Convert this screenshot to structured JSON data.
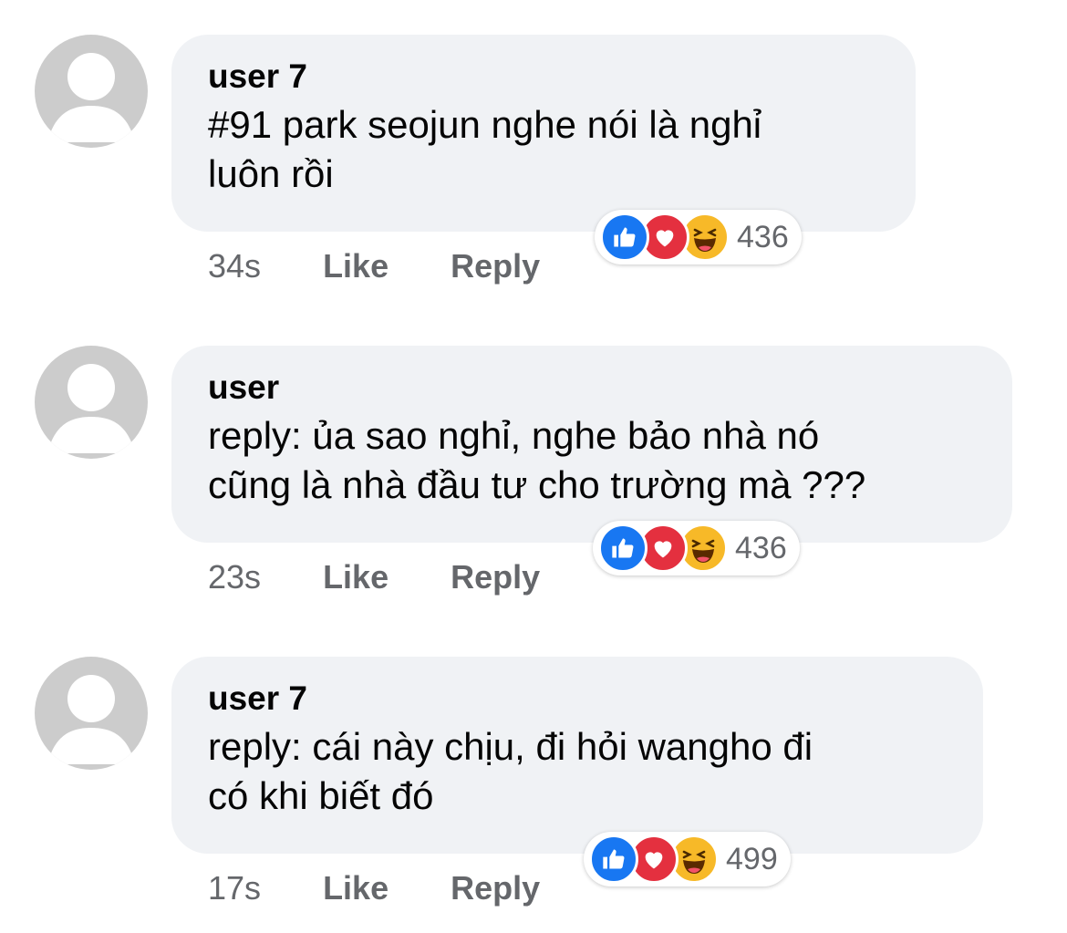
{
  "comments": [
    {
      "author": "user 7",
      "text": "#91 park seojun nghe nói là nghỉ\nluôn rồi",
      "time": "34s",
      "like_label": "Like",
      "reply_label": "Reply",
      "reaction_count": "436",
      "reactions": [
        "like-icon",
        "love-icon",
        "haha-icon"
      ]
    },
    {
      "author": "user",
      "text": "reply: ủa sao nghỉ, nghe bảo nhà nó\ncũng là nhà đầu tư cho trường mà ???",
      "time": "23s",
      "like_label": "Like",
      "reply_label": "Reply",
      "reaction_count": "436",
      "reactions": [
        "like-icon",
        "love-icon",
        "haha-icon"
      ]
    },
    {
      "author": "user 7",
      "text": "reply: cái này chịu, đi hỏi wangho đi\ncó khi biết đó",
      "time": "17s",
      "like_label": "Like",
      "reply_label": "Reply",
      "reaction_count": "499",
      "reactions": [
        "like-icon",
        "love-icon",
        "haha-icon"
      ]
    }
  ],
  "colors": {
    "bubble": "#f0f2f5",
    "meta_text": "#65676b",
    "like": "#1877f2",
    "love": "#e4303f",
    "haha": "#f7b928"
  }
}
